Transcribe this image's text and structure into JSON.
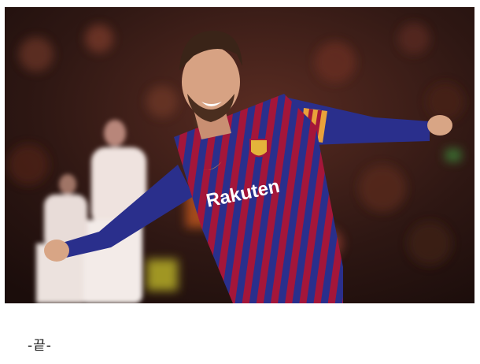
{
  "photo": {
    "description_alt": "",
    "jersey_sponsor": "Rakuten",
    "colors": {
      "jersey_blue": "#2a2f8c",
      "jersey_red": "#a4163a",
      "captain_band": "#e9a23a",
      "crowd_dark": "#2b1613",
      "opponent_kit": "#efe3df"
    }
  },
  "caption": {
    "text": "-끝-"
  }
}
